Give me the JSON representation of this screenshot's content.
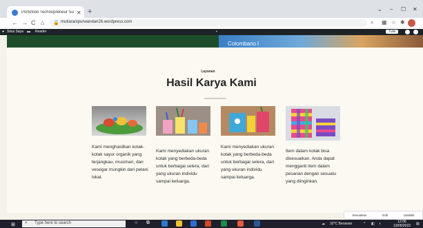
{
  "browser": {
    "tab_title": "Portofolio Technopreneur Suru",
    "new_tab": "+",
    "url": "mutiaranipurwandari26.wordpress.com",
    "nav": {
      "back": "←",
      "forward": "→",
      "reload": "C",
      "home": "⌂"
    },
    "window_controls": {
      "chevron": "⌄",
      "minimize": "–",
      "maximize": "☐",
      "close": "✕"
    }
  },
  "wp_admin": {
    "site_label": "Situs Saya",
    "reader_label": "Reader",
    "write_label": "Tulis"
  },
  "hero": {
    "text": "Colombano l"
  },
  "section": {
    "eyebrow": "Layanan",
    "title": "Hasil Karya Kami",
    "cards": [
      {
        "text": "Kami menghasilkan kotak-kotak sayur organik yang terjangkau, musiman, dan vesegar mungkin dari petani lokal.",
        "image": "clay-turtle-photo"
      },
      {
        "text": "Kami menyediakan ukuran kotak yang berbeda-beda untuk berbagai selera, dari yang ukuran individu sampai keluarga.",
        "image": "colorful-pencil-holders-photo"
      },
      {
        "text": "Kami menyediakan ukuran kotak yang berbeda-beda untuk berbagai selera, dari yang ukuran individu sampai keluarga.",
        "image": "craft-pencil-box-photo"
      },
      {
        "text": "Item dalam kotak bisa disesuaikan. Anda dapat mengganti item dalam pesanan dengan sesuatu yang diinginkan.",
        "image": "woven-paper-box-photo"
      }
    ]
  },
  "floating_toolbar": {
    "items": [
      "Sesuaikan",
      "Edit",
      "Statistik"
    ]
  },
  "taskbar": {
    "search_placeholder": "Type here to search",
    "weather": "32°C  Berawan",
    "time": "12:06",
    "date": "13/05/2022"
  },
  "colors": {
    "accent": "#1e4d2b",
    "wpbar": "#1d2327",
    "taskbar": "#1f1f2b"
  }
}
